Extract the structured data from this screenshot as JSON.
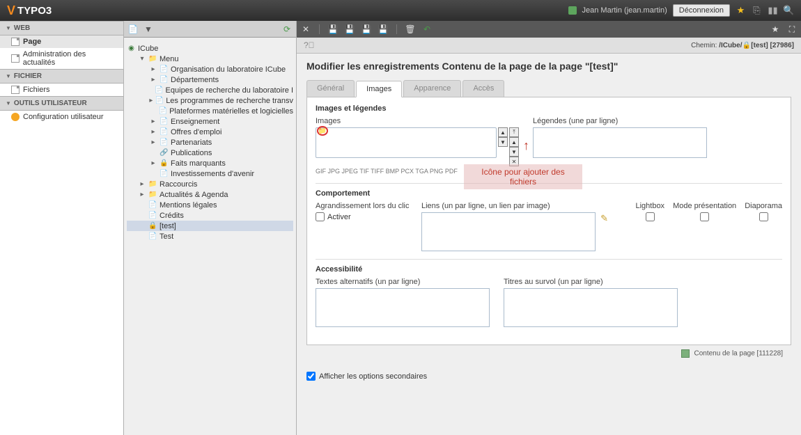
{
  "brand": "TYPO3",
  "user": {
    "display": "Jean Martin (jean.martin)",
    "logout": "Déconnexion"
  },
  "sidebar": {
    "sections": [
      {
        "title": "WEB",
        "items": [
          {
            "label": "Page",
            "active": true,
            "icon": "page"
          },
          {
            "label": "Administration des actualités",
            "icon": "page"
          }
        ]
      },
      {
        "title": "FICHIER",
        "items": [
          {
            "label": "Fichiers",
            "icon": "page"
          }
        ]
      },
      {
        "title": "OUTILS UTILISATEUR",
        "items": [
          {
            "label": "Configuration utilisateur",
            "icon": "user"
          }
        ]
      }
    ]
  },
  "tree": {
    "root": "ICube",
    "nodes": [
      {
        "level": 1,
        "expand": "▾",
        "icon": "folder",
        "label": "Menu"
      },
      {
        "level": 2,
        "expand": "▸",
        "icon": "doc",
        "label": "Organisation du laboratoire ICube"
      },
      {
        "level": 2,
        "expand": "▸",
        "icon": "doc",
        "label": "Départements"
      },
      {
        "level": 2,
        "expand": "",
        "icon": "doc",
        "label": "Equipes de recherche du laboratoire I"
      },
      {
        "level": 2,
        "expand": "▸",
        "icon": "doc",
        "label": "Les programmes de recherche transv"
      },
      {
        "level": 2,
        "expand": "",
        "icon": "doc",
        "label": "Plateformes matérielles et logicielles"
      },
      {
        "level": 2,
        "expand": "▸",
        "icon": "doc",
        "label": "Enseignement"
      },
      {
        "level": 2,
        "expand": "▸",
        "icon": "doc",
        "label": "Offres d'emploi"
      },
      {
        "level": 2,
        "expand": "▸",
        "icon": "doc",
        "label": "Partenariats"
      },
      {
        "level": 2,
        "expand": "",
        "icon": "link",
        "label": "Publications"
      },
      {
        "level": 2,
        "expand": "▸",
        "icon": "lock",
        "label": "Faits marquants"
      },
      {
        "level": 2,
        "expand": "",
        "icon": "doc",
        "label": "Investissements d'avenir"
      },
      {
        "level": 1,
        "expand": "▸",
        "icon": "folder",
        "label": "Raccourcis"
      },
      {
        "level": 1,
        "expand": "▸",
        "icon": "folder",
        "label": "Actualités & Agenda"
      },
      {
        "level": 1,
        "expand": "",
        "icon": "doc",
        "label": "Mentions légales"
      },
      {
        "level": 1,
        "expand": "",
        "icon": "doc",
        "label": "Crédits"
      },
      {
        "level": 1,
        "expand": "",
        "icon": "lock",
        "label": "[test]",
        "selected": true
      },
      {
        "level": 1,
        "expand": "",
        "icon": "doc",
        "label": "Test"
      }
    ]
  },
  "breadcrumb": {
    "prefix": "Chemin:",
    "path": "/ICube/",
    "current": "[test]",
    "id": "[27986]"
  },
  "page": {
    "title": "Modifier les enregistrements Contenu de la page de la page \"[test]\"",
    "tabs": [
      "Général",
      "Images",
      "Apparence",
      "Accès"
    ],
    "active_tab": 1,
    "sections": {
      "images_legends": {
        "heading": "Images et légendes",
        "images_label": "Images",
        "hint": "GIF JPG JPEG TIF TIFF BMP PCX TGA PNG PDF",
        "captions_label": "Légendes (une par ligne)"
      },
      "behavior": {
        "heading": "Comportement",
        "enlarge_label": "Agrandissement lors du clic",
        "activate": "Activer",
        "links_label": "Liens (un par ligne, un lien par image)",
        "lightbox": "Lightbox",
        "presentation": "Mode présentation",
        "diaporama": "Diaporama"
      },
      "accessibility": {
        "heading": "Accessibilité",
        "alts_label": "Textes alternatifs (un par ligne)",
        "titles_label": "Titres au survol (un par ligne)"
      }
    },
    "annotation": "Icône pour ajouter des fichiers",
    "secondary_label": "Afficher les options secondaires",
    "footer": {
      "label": "Contenu de la page",
      "id": "[111228]"
    }
  }
}
